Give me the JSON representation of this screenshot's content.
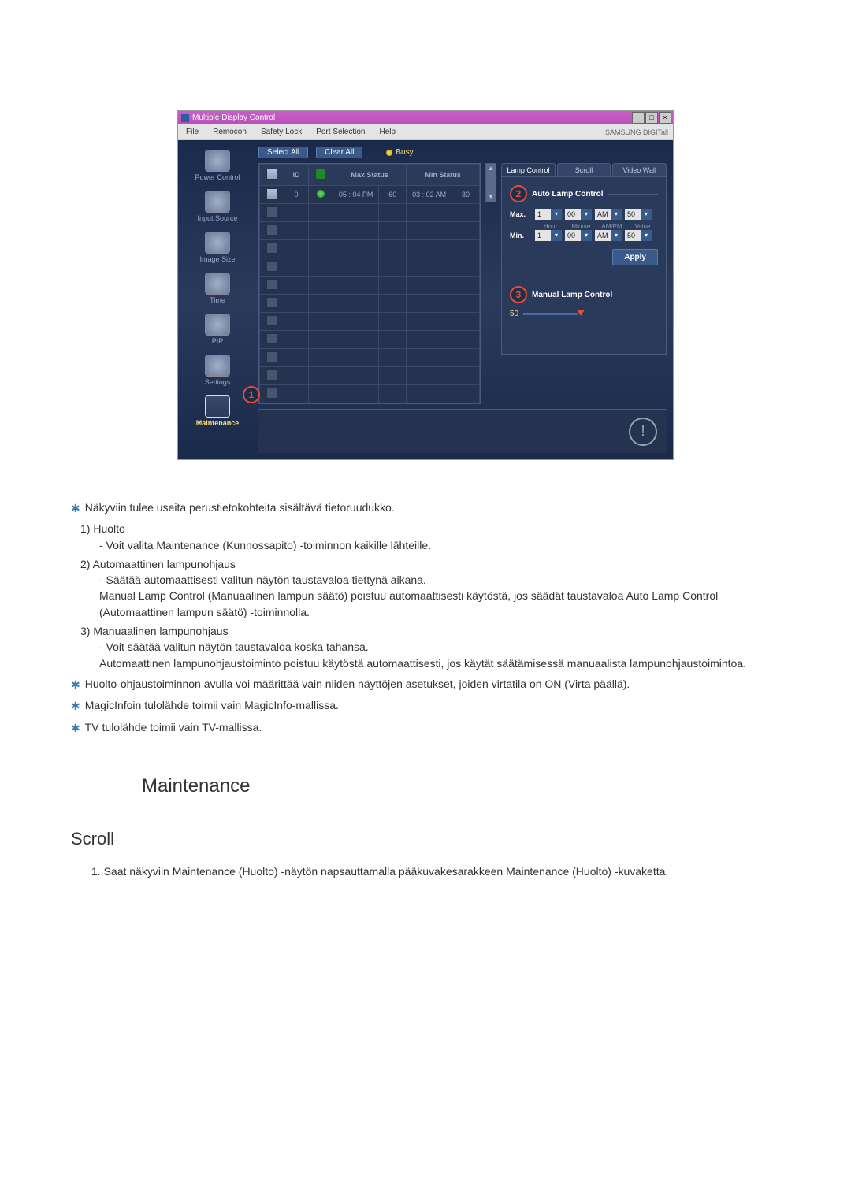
{
  "app": {
    "title": "Multiple Display Control",
    "brand": "SAMSUNG DIGITall",
    "win_min": "_",
    "win_max": "□",
    "win_close": "×"
  },
  "menu": {
    "file": "File",
    "remocon": "Remocon",
    "safety": "Safety Lock",
    "port": "Port Selection",
    "help": "Help"
  },
  "sidebar": {
    "items": [
      {
        "label": "Power Control"
      },
      {
        "label": "Input Source"
      },
      {
        "label": "Image Size"
      },
      {
        "label": "Time"
      },
      {
        "label": "PIP"
      },
      {
        "label": "Settings"
      },
      {
        "label": "Maintenance"
      }
    ]
  },
  "top_buttons": {
    "select_all": "Select All",
    "clear_all": "Clear All",
    "busy": "Busy"
  },
  "grid": {
    "headers": {
      "id": "ID",
      "max": "Max Status",
      "min": "Min Status"
    },
    "row": {
      "id": "0",
      "max_time": "05 : 04 PM",
      "max_val": "60",
      "min_time": "03 : 02 AM",
      "min_val": "80"
    }
  },
  "panel": {
    "tabs": {
      "lamp": "Lamp Control",
      "scroll": "Scroll",
      "video": "Video Wall"
    },
    "auto_title": "Auto Lamp Control",
    "manual_title": "Manual Lamp Control",
    "max_label": "Max.",
    "min_label": "Min.",
    "apply": "Apply",
    "sub_hour": "Hour",
    "sub_min": "Minute",
    "sub_ampm": "AM/PM",
    "sub_val": "Value",
    "slider_val": "50",
    "f_hour": "1",
    "f_min": "00",
    "f_ampm": "AM",
    "f_val": "50"
  },
  "callouts": {
    "c1": "1",
    "c2": "2",
    "c3": "3"
  },
  "chart_data": {
    "type": "table",
    "title": "Lamp Control Status",
    "columns": [
      "ID",
      "Max Status Time",
      "Max Status Value",
      "Min Status Time",
      "Min Status Value"
    ],
    "rows": [
      [
        "0",
        "05 : 04 PM",
        60,
        "03 : 02 AM",
        80
      ]
    ],
    "settings": {
      "auto_lamp": {
        "max": {
          "hour": 1,
          "minute": 0,
          "ampm": "AM",
          "value": 50
        },
        "min": {
          "hour": 1,
          "minute": 0,
          "ampm": "AM",
          "value": 50
        }
      },
      "manual_lamp": {
        "value": 50,
        "range": [
          0,
          100
        ]
      }
    }
  },
  "doc": {
    "star1": "Näkyviin tulee useita perustietokohteita sisältävä tietoruudukko.",
    "n1_head": "1)  Huolto",
    "n1_body": "- Voit valita Maintenance (Kunnossapito) -toiminnon kaikille lähteille.",
    "n2_head": "2)  Automaattinen lampunohjaus",
    "n2_b1": "- Säätää automaattisesti valitun näytön taustavaloa tiettynä aikana.",
    "n2_b2": "Manual Lamp Control (Manuaalinen lampun säätö) poistuu automaattisesti käytöstä, jos säädät taustavaloa Auto Lamp Control (Automaattinen lampun säätö) -toiminnolla.",
    "n3_head": "3)  Manuaalinen lampunohjaus",
    "n3_b1": "- Voit säätää valitun näytön taustavaloa koska tahansa.",
    "n3_b2": "Automaattinen lampunohjaustoiminto poistuu käytöstä automaattisesti, jos käytät säätämisessä manuaalista lampunohjaustoimintoa.",
    "star2": "Huolto-ohjaustoiminnon avulla voi määrittää vain niiden näyttöjen asetukset, joiden virtatila on ON (Virta päällä).",
    "star3": "MagicInfoin tulolähde toimii vain MagicInfo-mallissa.",
    "star4": "TV tulolähde toimii vain TV-mallissa.",
    "section": "Maintenance",
    "sub": "Scroll",
    "step1": "1.  Saat näkyviin Maintenance (Huolto) -näytön napsauttamalla pääkuvakesarakkeen Maintenance (Huolto) -kuvaketta."
  }
}
